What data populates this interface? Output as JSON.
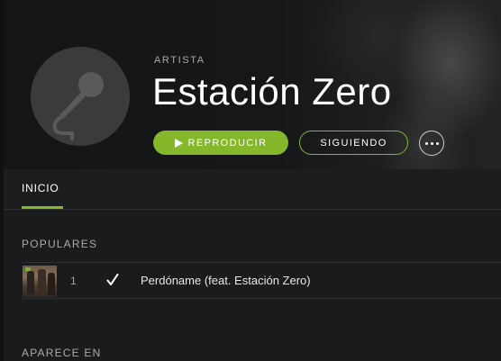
{
  "header": {
    "type_label": "ARTISTA",
    "artist_name": "Estación Zero",
    "avatar_icon": "microphone-icon",
    "play_label": "REPRODUCIR",
    "follow_label": "SIGUIENDO",
    "more_icon": "more-options-icon"
  },
  "tabs": [
    {
      "label": "INICIO",
      "active": true
    }
  ],
  "sections": {
    "popular_title": "POPULARES",
    "appears_title": "APARECE EN"
  },
  "tracks": [
    {
      "number": "1",
      "saved_icon": "check-icon",
      "name": "Perdóname (feat. Estación Zero)"
    }
  ],
  "colors": {
    "accent": "#84b82a",
    "background": "#1c1d1f",
    "text": "#ffffff",
    "muted": "#a8a9ab"
  }
}
